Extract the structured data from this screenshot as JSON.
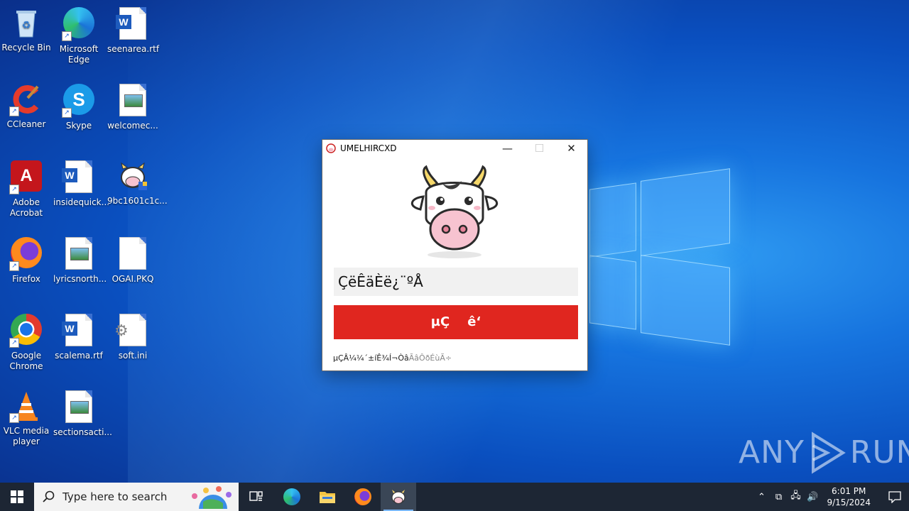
{
  "desktop": {
    "icons": [
      {
        "label": "Recycle Bin"
      },
      {
        "label": "Microsoft Edge"
      },
      {
        "label": "seenarea.rtf"
      },
      {
        "label": "CCleaner"
      },
      {
        "label": "Skype"
      },
      {
        "label": "welcomec..."
      },
      {
        "label": "Adobe Acrobat"
      },
      {
        "label": "insidequick..."
      },
      {
        "label": "9bc1601c1c..."
      },
      {
        "label": "Firefox"
      },
      {
        "label": "lyricsnorth..."
      },
      {
        "label": "OGAI.PKQ"
      },
      {
        "label": "Google Chrome"
      },
      {
        "label": "scalema.rtf"
      },
      {
        "label": "soft.ini"
      },
      {
        "label": "VLC media player"
      },
      {
        "label": "sectionsacti..."
      }
    ]
  },
  "window": {
    "title": "UMELHIRCXD",
    "input_value": "ÇëÊäÈë¿¨ºÅ",
    "button_label": "µÇ    ê‘",
    "footer_main": "µÇÂ¼¼´±íÊ¾Í¬Òâ",
    "footer_gray": "ÃâÔðÉùÃ÷"
  },
  "watermark": {
    "left": "ANY",
    "right": "RUN"
  },
  "taskbar": {
    "search_placeholder": "Type here to search",
    "time": "6:01 PM",
    "date": "9/15/2024"
  },
  "colors": {
    "accent_button": "#e0261f",
    "taskbar": "#1d2634"
  }
}
